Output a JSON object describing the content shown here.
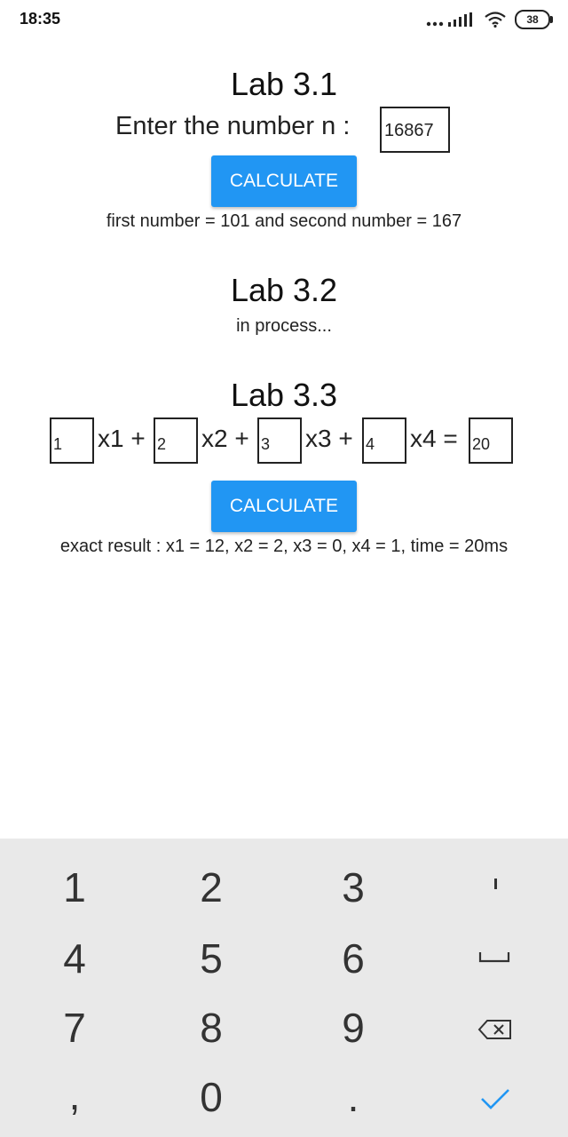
{
  "status_bar": {
    "time": "18:35",
    "battery": "38"
  },
  "lab31": {
    "title": "Lab 3.1",
    "prompt_label": "Enter the number n :",
    "n_value": "16867",
    "button_label": "CALCULATE",
    "result": "first number = 101 and second number = 167"
  },
  "lab32": {
    "title": "Lab 3.2",
    "status": "in process..."
  },
  "lab33": {
    "title": "Lab 3.3",
    "coefficients": [
      "1",
      "2",
      "3",
      "4"
    ],
    "terms": [
      "x1 +",
      "x2 +",
      "x3 +",
      "x4 ="
    ],
    "rhs": "20",
    "button_label": "CALCULATE",
    "result": "exact result : x1 = 12, x2 = 2, x3 = 0, x4 = 1, time = 20ms"
  },
  "keyboard": {
    "keys": [
      "1",
      "2",
      "3",
      "4",
      "5",
      "6",
      "7",
      "8",
      "9",
      ",",
      "0",
      "."
    ],
    "icons": [
      "minus-icon",
      "space-icon",
      "backspace-icon",
      "done-checkmark-icon"
    ],
    "accent_color": "#2196f3"
  }
}
